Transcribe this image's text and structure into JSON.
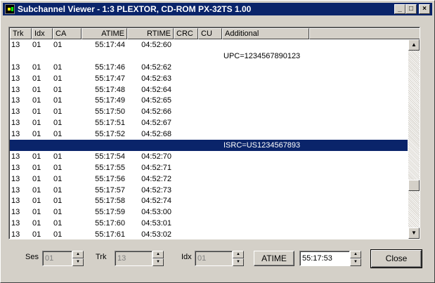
{
  "window": {
    "title": "Subchannel Viewer - 1:3 PLEXTOR, CD-ROM PX-32TS 1.00",
    "minimize_glyph": "_",
    "maximize_glyph": "□",
    "close_glyph": "×"
  },
  "list": {
    "columns": [
      "Trk",
      "Idx",
      "CA",
      "ATIME",
      "RTIME",
      "CRC",
      "CU",
      "Additional"
    ],
    "rows": [
      {
        "trk": "13",
        "idx": "01",
        "ca": "01",
        "atime": "55:17:44",
        "rtime": "04:52:60",
        "crc": "",
        "cu": "",
        "additional": ""
      },
      {
        "trk": "",
        "idx": "",
        "ca": "",
        "atime": "",
        "rtime": "",
        "crc": "",
        "cu": "",
        "additional": "UPC=1234567890123"
      },
      {
        "trk": "13",
        "idx": "01",
        "ca": "01",
        "atime": "55:17:46",
        "rtime": "04:52:62",
        "crc": "",
        "cu": "",
        "additional": ""
      },
      {
        "trk": "13",
        "idx": "01",
        "ca": "01",
        "atime": "55:17:47",
        "rtime": "04:52:63",
        "crc": "",
        "cu": "",
        "additional": ""
      },
      {
        "trk": "13",
        "idx": "01",
        "ca": "01",
        "atime": "55:17:48",
        "rtime": "04:52:64",
        "crc": "",
        "cu": "",
        "additional": ""
      },
      {
        "trk": "13",
        "idx": "01",
        "ca": "01",
        "atime": "55:17:49",
        "rtime": "04:52:65",
        "crc": "",
        "cu": "",
        "additional": ""
      },
      {
        "trk": "13",
        "idx": "01",
        "ca": "01",
        "atime": "55:17:50",
        "rtime": "04:52:66",
        "crc": "",
        "cu": "",
        "additional": ""
      },
      {
        "trk": "13",
        "idx": "01",
        "ca": "01",
        "atime": "55:17:51",
        "rtime": "04:52:67",
        "crc": "",
        "cu": "",
        "additional": ""
      },
      {
        "trk": "13",
        "idx": "01",
        "ca": "01",
        "atime": "55:17:52",
        "rtime": "04:52:68",
        "crc": "",
        "cu": "",
        "additional": ""
      },
      {
        "trk": "",
        "idx": "",
        "ca": "",
        "atime": "",
        "rtime": "",
        "crc": "",
        "cu": "",
        "additional": "ISRC=US1234567893",
        "selected": true
      },
      {
        "trk": "13",
        "idx": "01",
        "ca": "01",
        "atime": "55:17:54",
        "rtime": "04:52:70",
        "crc": "",
        "cu": "",
        "additional": ""
      },
      {
        "trk": "13",
        "idx": "01",
        "ca": "01",
        "atime": "55:17:55",
        "rtime": "04:52:71",
        "crc": "",
        "cu": "",
        "additional": ""
      },
      {
        "trk": "13",
        "idx": "01",
        "ca": "01",
        "atime": "55:17:56",
        "rtime": "04:52:72",
        "crc": "",
        "cu": "",
        "additional": ""
      },
      {
        "trk": "13",
        "idx": "01",
        "ca": "01",
        "atime": "55:17:57",
        "rtime": "04:52:73",
        "crc": "",
        "cu": "",
        "additional": ""
      },
      {
        "trk": "13",
        "idx": "01",
        "ca": "01",
        "atime": "55:17:58",
        "rtime": "04:52:74",
        "crc": "",
        "cu": "",
        "additional": ""
      },
      {
        "trk": "13",
        "idx": "01",
        "ca": "01",
        "atime": "55:17:59",
        "rtime": "04:53:00",
        "crc": "",
        "cu": "",
        "additional": ""
      },
      {
        "trk": "13",
        "idx": "01",
        "ca": "01",
        "atime": "55:17:60",
        "rtime": "04:53:01",
        "crc": "",
        "cu": "",
        "additional": ""
      },
      {
        "trk": "13",
        "idx": "01",
        "ca": "01",
        "atime": "55:17:61",
        "rtime": "04:53:02",
        "crc": "",
        "cu": "",
        "additional": ""
      }
    ],
    "scroll_position_fraction": 0.78
  },
  "controls": {
    "ses_label": "Ses",
    "ses_value": "01",
    "trk_label": "Trk",
    "trk_value": "13",
    "idx_label": "Idx",
    "idx_value": "01",
    "atime_button": "ATIME",
    "atime_value": "55:17:53",
    "close_button": "Close"
  },
  "icons": {
    "up": "▲",
    "down": "▼"
  },
  "colors": {
    "titlebar": "#0a246a",
    "selection": "#0a246a",
    "face": "#d4d0c8"
  }
}
